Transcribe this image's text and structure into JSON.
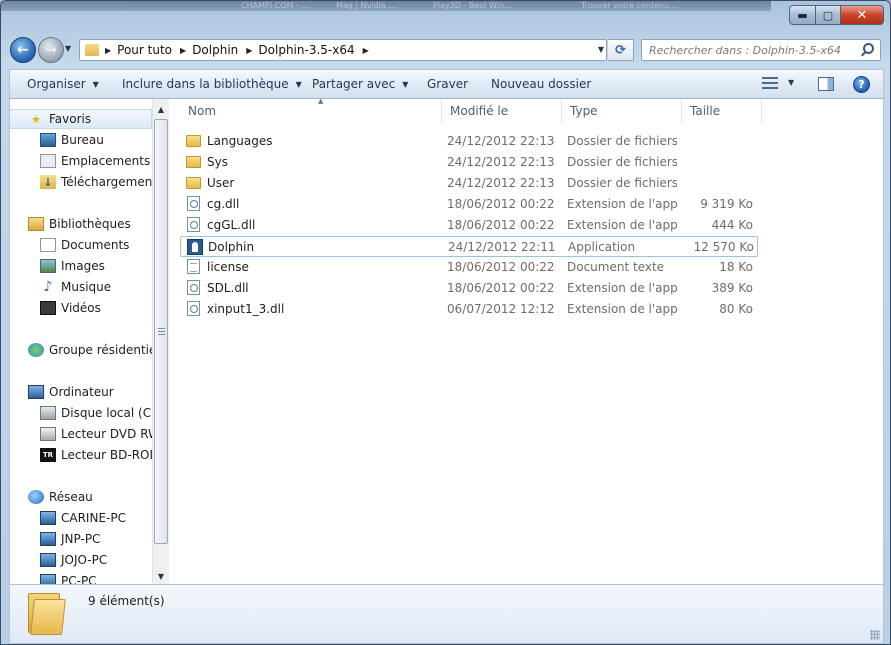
{
  "background_tabs": [
    "CHAMPI COM - ...",
    "Mag | Nvidia ...",
    "Play3D - Best Win...",
    "Trouver votre contenu..."
  ],
  "window": {
    "min_glyph": "▬",
    "max_glyph": "▢",
    "close_glyph": "✕"
  },
  "navigation": {
    "breadcrumb": [
      "Pour tuto",
      "Dolphin",
      "Dolphin-3.5-x64"
    ],
    "search_placeholder": "Rechercher dans : Dolphin-3.5-x64"
  },
  "toolbar": {
    "organize": "Organiser",
    "include_library": "Inclure dans la bibliothèque",
    "share_with": "Partager avec",
    "burn": "Graver",
    "new_folder": "Nouveau dossier"
  },
  "sidebar": {
    "favorites": {
      "label": "Favoris",
      "items": [
        "Bureau",
        "Emplacements ré",
        "Téléchargements"
      ]
    },
    "libraries": {
      "label": "Bibliothèques",
      "items": [
        "Documents",
        "Images",
        "Musique",
        "Vidéos"
      ]
    },
    "homegroup": {
      "label": "Groupe résidentiel"
    },
    "computer": {
      "label": "Ordinateur",
      "items": [
        "Disque local (C:)",
        "Lecteur DVD RW",
        "Lecteur BD-ROM"
      ]
    },
    "network": {
      "label": "Réseau",
      "items": [
        "CARINE-PC",
        "JNP-PC",
        "JOJO-PC",
        "PC-PC"
      ]
    }
  },
  "columns": {
    "name": "Nom",
    "modified": "Modifié le",
    "type": "Type",
    "size": "Taille"
  },
  "files": [
    {
      "name": "Languages",
      "modified": "24/12/2012 22:13",
      "type": "Dossier de fichiers",
      "size": "",
      "icon": "folder"
    },
    {
      "name": "Sys",
      "modified": "24/12/2012 22:13",
      "type": "Dossier de fichiers",
      "size": "",
      "icon": "folder"
    },
    {
      "name": "User",
      "modified": "24/12/2012 22:13",
      "type": "Dossier de fichiers",
      "size": "",
      "icon": "folder"
    },
    {
      "name": "cg.dll",
      "modified": "18/06/2012 00:22",
      "type": "Extension de l'app...",
      "size": "9 319 Ko",
      "icon": "dll"
    },
    {
      "name": "cgGL.dll",
      "modified": "18/06/2012 00:22",
      "type": "Extension de l'app...",
      "size": "444 Ko",
      "icon": "dll"
    },
    {
      "name": "Dolphin",
      "modified": "24/12/2012 22:11",
      "type": "Application",
      "size": "12 570 Ko",
      "icon": "app"
    },
    {
      "name": "license",
      "modified": "18/06/2012 00:22",
      "type": "Document texte",
      "size": "18 Ko",
      "icon": "txt"
    },
    {
      "name": "SDL.dll",
      "modified": "18/06/2012 00:22",
      "type": "Extension de l'app...",
      "size": "389 Ko",
      "icon": "dll"
    },
    {
      "name": "xinput1_3.dll",
      "modified": "06/07/2012 12:12",
      "type": "Extension de l'app...",
      "size": "80 Ko",
      "icon": "dll"
    }
  ],
  "status": {
    "item_count": "9 élément(s)"
  }
}
